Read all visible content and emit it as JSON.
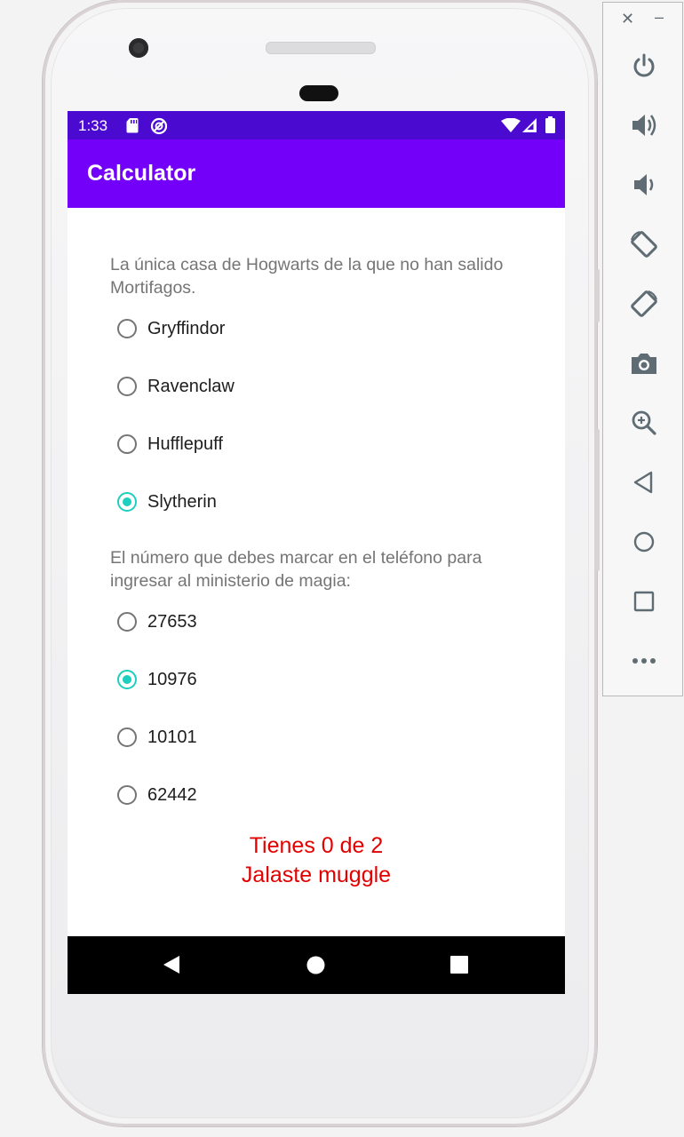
{
  "status_bar": {
    "time": "1:33"
  },
  "app_bar": {
    "title": "Calculator"
  },
  "question1": {
    "text": "La única casa de Hogwarts de la que no han salido Mortifagos.",
    "options": [
      {
        "label": "Gryffindor",
        "checked": false
      },
      {
        "label": "Ravenclaw",
        "checked": false
      },
      {
        "label": "Hufflepuff",
        "checked": false
      },
      {
        "label": "Slytherin",
        "checked": true
      }
    ]
  },
  "question2": {
    "text": "El número que debes marcar en el teléfono para ingresar al ministerio de magia:",
    "options": [
      {
        "label": "27653",
        "checked": false
      },
      {
        "label": "10976",
        "checked": true
      },
      {
        "label": "10101",
        "checked": false
      },
      {
        "label": "62442",
        "checked": false
      }
    ]
  },
  "result": {
    "line1": "Tienes 0 de 2",
    "line2": "Jalaste muggle"
  },
  "colors": {
    "status_bar": "#4b0ad0",
    "app_bar": "#7300f8",
    "radio_checked": "#1ccfbf",
    "result_text": "#e30000"
  },
  "emulator_panel": {
    "buttons": [
      "close-icon",
      "minimize-icon",
      "power-icon",
      "volume-up-icon",
      "volume-down-icon",
      "rotate-left-icon",
      "rotate-right-icon",
      "camera-icon",
      "zoom-icon",
      "back-icon",
      "home-icon",
      "overview-icon",
      "more-icon"
    ]
  }
}
